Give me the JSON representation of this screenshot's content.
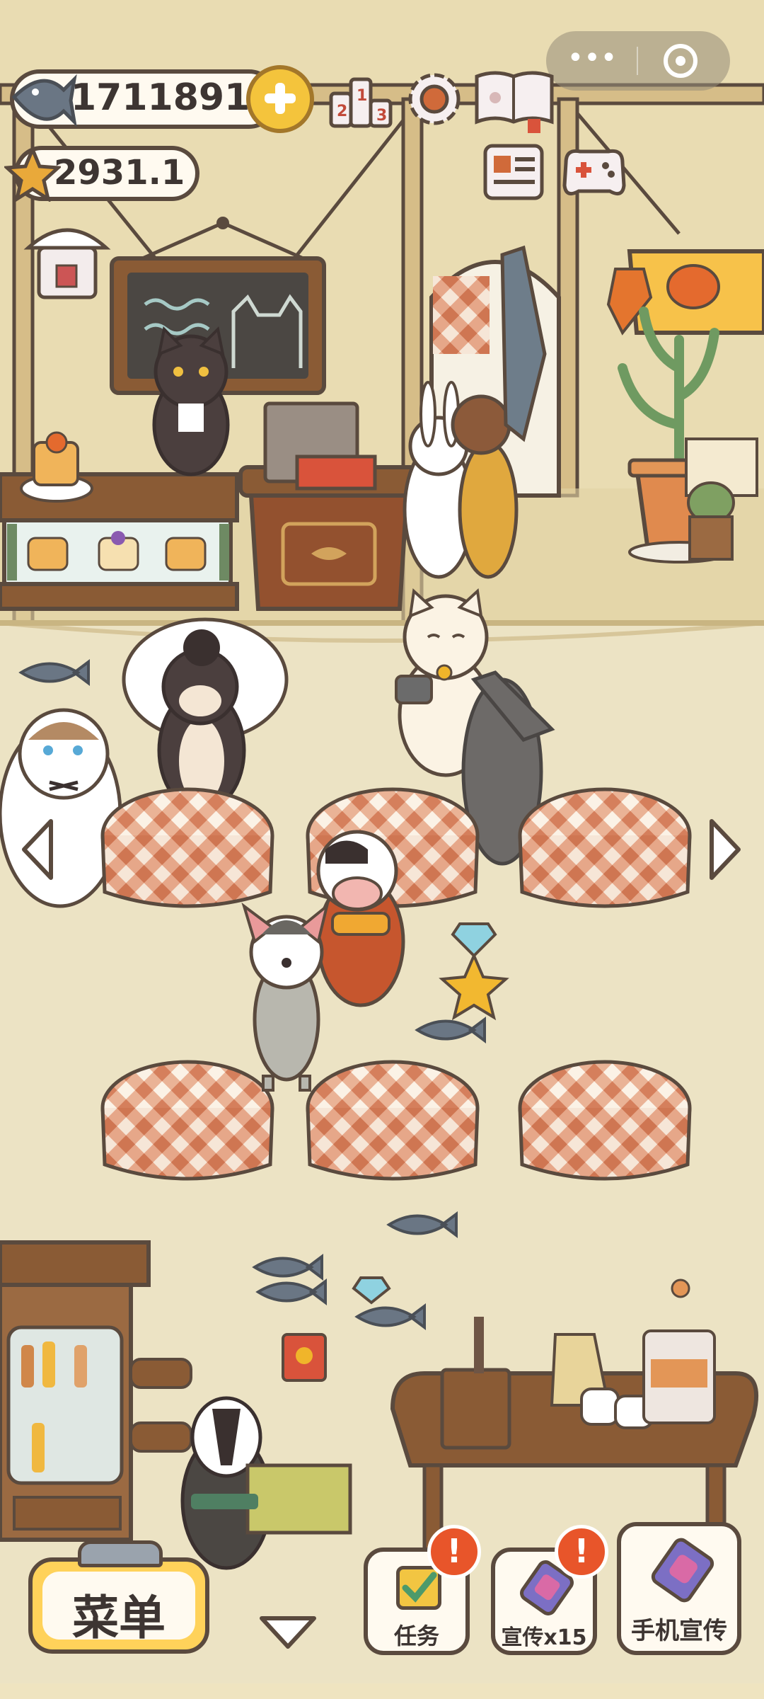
{
  "hud": {
    "fish_currency": "1711891",
    "star_currency": "2931.1",
    "icons": [
      "fish-icon",
      "plus-icon",
      "ranking-podium-icon",
      "settings-gear-icon",
      "paw-book-icon",
      "shop-awning-icon",
      "newspaper-icon",
      "gamepad-icon",
      "lantern-event-icon",
      "star-icon"
    ]
  },
  "bottom_bar": {
    "menu_label": "菜单",
    "tasks_label": "任务",
    "promo_label": "宣传x15",
    "phone_promo_label": "手机宣传",
    "tasks_badge": "!",
    "promo_badge": "!"
  },
  "colors": {
    "background": "#efe4c0",
    "wall": "#e9dcb2",
    "floor": "#ece3c4",
    "tablecloth": "#e0916e",
    "menu_button": "#ffd25a",
    "badge": "#e8552a",
    "outline": "#5a4a3e"
  }
}
